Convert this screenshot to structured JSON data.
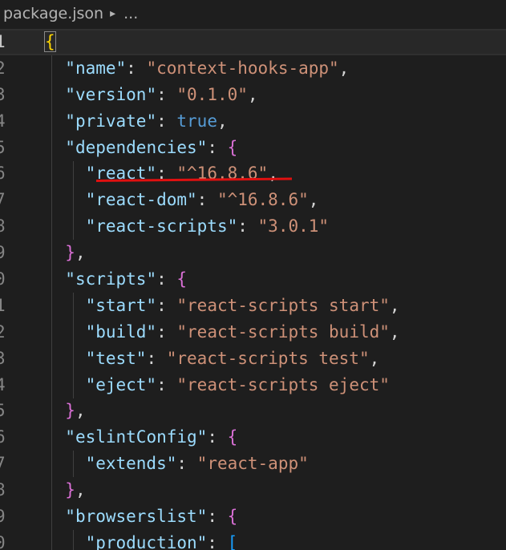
{
  "breadcrumb": {
    "file": "package.json",
    "separator": "▸",
    "ellipsis": "..."
  },
  "lines": [
    {
      "num": "1",
      "parts": [
        [
          "br1 bracket-hl",
          "{"
        ]
      ]
    },
    {
      "num": "2",
      "parts": [
        [
          "p",
          "  "
        ],
        [
          "k",
          "\"name\""
        ],
        [
          "p",
          ": "
        ],
        [
          "s",
          "\"context-hooks-app\""
        ],
        [
          "p",
          ","
        ]
      ]
    },
    {
      "num": "3",
      "parts": [
        [
          "p",
          "  "
        ],
        [
          "k",
          "\"version\""
        ],
        [
          "p",
          ": "
        ],
        [
          "s",
          "\"0.1.0\""
        ],
        [
          "p",
          ","
        ]
      ]
    },
    {
      "num": "4",
      "parts": [
        [
          "p",
          "  "
        ],
        [
          "k",
          "\"private\""
        ],
        [
          "p",
          ": "
        ],
        [
          "b",
          "true"
        ],
        [
          "p",
          ","
        ]
      ]
    },
    {
      "num": "5",
      "parts": [
        [
          "p",
          "  "
        ],
        [
          "k",
          "\"dependencies\""
        ],
        [
          "p",
          ": "
        ],
        [
          "br2",
          "{"
        ]
      ]
    },
    {
      "num": "6",
      "parts": [
        [
          "p",
          "    "
        ],
        [
          "k",
          "\"react\""
        ],
        [
          "p",
          ": "
        ],
        [
          "s",
          "\"^16.8.6\""
        ],
        [
          "p",
          ","
        ]
      ]
    },
    {
      "num": "7",
      "parts": [
        [
          "p",
          "    "
        ],
        [
          "k",
          "\"react-dom\""
        ],
        [
          "p",
          ": "
        ],
        [
          "s",
          "\"^16.8.6\""
        ],
        [
          "p",
          ","
        ]
      ]
    },
    {
      "num": "8",
      "parts": [
        [
          "p",
          "    "
        ],
        [
          "k",
          "\"react-scripts\""
        ],
        [
          "p",
          ": "
        ],
        [
          "s",
          "\"3.0.1\""
        ]
      ]
    },
    {
      "num": "9",
      "parts": [
        [
          "p",
          "  "
        ],
        [
          "br2",
          "}"
        ],
        [
          "p",
          ","
        ]
      ]
    },
    {
      "num": "0",
      "parts": [
        [
          "p",
          "  "
        ],
        [
          "k",
          "\"scripts\""
        ],
        [
          "p",
          ": "
        ],
        [
          "br2",
          "{"
        ]
      ]
    },
    {
      "num": "1",
      "parts": [
        [
          "p",
          "    "
        ],
        [
          "k",
          "\"start\""
        ],
        [
          "p",
          ": "
        ],
        [
          "s",
          "\"react-scripts start\""
        ],
        [
          "p",
          ","
        ]
      ]
    },
    {
      "num": "2",
      "parts": [
        [
          "p",
          "    "
        ],
        [
          "k",
          "\"build\""
        ],
        [
          "p",
          ": "
        ],
        [
          "s",
          "\"react-scripts build\""
        ],
        [
          "p",
          ","
        ]
      ]
    },
    {
      "num": "3",
      "parts": [
        [
          "p",
          "    "
        ],
        [
          "k",
          "\"test\""
        ],
        [
          "p",
          ": "
        ],
        [
          "s",
          "\"react-scripts test\""
        ],
        [
          "p",
          ","
        ]
      ]
    },
    {
      "num": "4",
      "parts": [
        [
          "p",
          "    "
        ],
        [
          "k",
          "\"eject\""
        ],
        [
          "p",
          ": "
        ],
        [
          "s",
          "\"react-scripts eject\""
        ]
      ]
    },
    {
      "num": "5",
      "parts": [
        [
          "p",
          "  "
        ],
        [
          "br2",
          "}"
        ],
        [
          "p",
          ","
        ]
      ]
    },
    {
      "num": "6",
      "parts": [
        [
          "p",
          "  "
        ],
        [
          "k",
          "\"eslintConfig\""
        ],
        [
          "p",
          ": "
        ],
        [
          "br2",
          "{"
        ]
      ]
    },
    {
      "num": "7",
      "parts": [
        [
          "p",
          "    "
        ],
        [
          "k",
          "\"extends\""
        ],
        [
          "p",
          ": "
        ],
        [
          "s",
          "\"react-app\""
        ]
      ]
    },
    {
      "num": "8",
      "parts": [
        [
          "p",
          "  "
        ],
        [
          "br2",
          "}"
        ],
        [
          "p",
          ","
        ]
      ]
    },
    {
      "num": "9",
      "parts": [
        [
          "p",
          "  "
        ],
        [
          "k",
          "\"browserslist\""
        ],
        [
          "p",
          ": "
        ],
        [
          "br2",
          "{"
        ]
      ]
    },
    {
      "num": "0",
      "parts": [
        [
          "p",
          "    "
        ],
        [
          "k",
          "\"production\""
        ],
        [
          "p",
          ": "
        ],
        [
          "br3",
          "["
        ]
      ]
    }
  ],
  "active_line_index": 0,
  "annotation": {
    "color": "#e01010",
    "target_line": "6"
  }
}
